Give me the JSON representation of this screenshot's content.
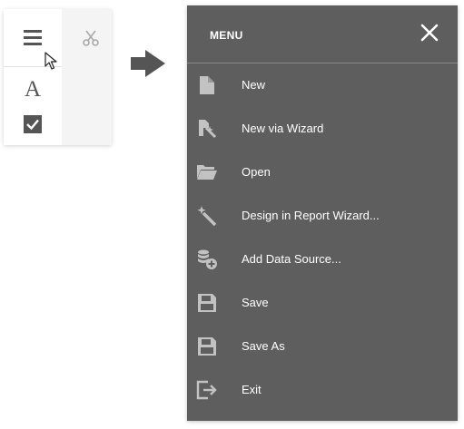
{
  "toolbar": {
    "icons": [
      "hamburger-icon",
      "scissors-icon",
      "font-icon",
      "checkbox-icon"
    ],
    "font_glyph": "A"
  },
  "menu": {
    "title": "MENU",
    "close_glyph": "✕",
    "items": [
      {
        "label": "New",
        "icon": "new-document-icon"
      },
      {
        "label": "New via Wizard",
        "icon": "new-via-wizard-icon"
      },
      {
        "label": "Open",
        "icon": "folder-open-icon"
      },
      {
        "label": "Design in Report Wizard...",
        "icon": "magic-wand-icon"
      },
      {
        "label": "Add Data Source...",
        "icon": "add-data-source-icon"
      },
      {
        "label": "Save",
        "icon": "save-icon"
      },
      {
        "label": "Save As",
        "icon": "save-as-icon"
      },
      {
        "label": "Exit",
        "icon": "exit-icon"
      }
    ]
  },
  "colors": {
    "menu_background": "#5e5e5e",
    "menu_icon": "#c2c2c2",
    "toolbar_icon": "#555555",
    "arrow": "#555555"
  }
}
